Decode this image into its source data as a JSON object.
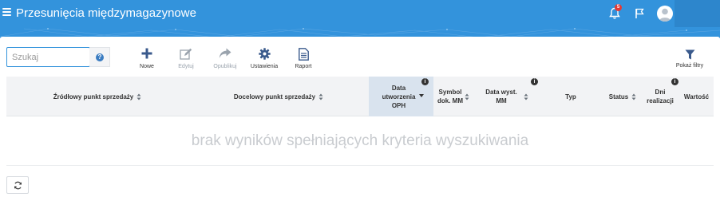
{
  "header": {
    "title": "Przesunięcia międzymagazynowe",
    "notification_count": "5",
    "menu_icon": "hamburger-icon",
    "bell_icon": "bell-icon",
    "flag_icon": "flag-icon",
    "avatar_icon": "user-avatar-icon",
    "bar_color": "#3393dc"
  },
  "search": {
    "placeholder": "Szukaj",
    "value": ""
  },
  "help_label": "?",
  "toolbar": {
    "new": "Nowe",
    "edit": "Edytuj",
    "publish": "Opublikuj",
    "settings": "Ustawienia",
    "report": "Raport",
    "filters": "Pokaż filtry"
  },
  "table": {
    "col_source": "Źródłowy punkt sprzedaży",
    "col_target": "Docelowy punkt sprzedaży",
    "col_created": "Data utworzenia OPH",
    "col_symbol": "Symbol dok. MM",
    "col_issued": "Data wyst. MM",
    "col_type": "Typ",
    "col_status": "Status",
    "col_days": "Dni realizacji",
    "col_value": "Wartość",
    "info_glyph": "i",
    "empty_message": "brak wyników spełniających kryteria wyszukiwania"
  },
  "footer": {
    "refresh_icon": "refresh-icon"
  }
}
